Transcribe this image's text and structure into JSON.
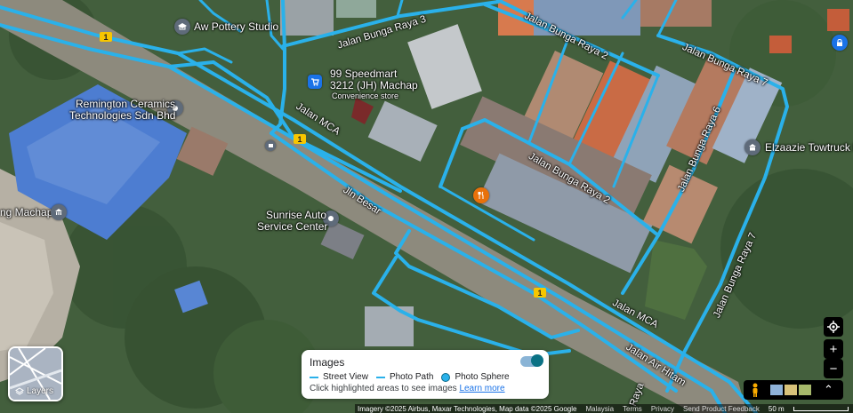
{
  "map": {
    "road_labels": {
      "bunga_raya_3": "Jalan Bunga Raya 3",
      "bunga_raya_2_top": "Jalan Bunga Raya 2",
      "bunga_raya_7_top": "Jalan Bunga Raya 7",
      "bunga_raya_6": "Jalan Bunga Raya 6",
      "bunga_raya_2_mid": "Jalan Bunga Raya 2",
      "bunga_raya_7_right": "Jalan Bunga Raya 7",
      "mca_top": "Jalan MCA",
      "mca_bottom": "Jalan MCA",
      "jln_besar": "Jln Besar",
      "air_hitam": "Jalan Air Hitam",
      "raya_partial": "Raya"
    },
    "route_shields": [
      "1",
      "1",
      "1"
    ],
    "places": {
      "aw_pottery": "Aw Pottery Studio",
      "speedmart_line1": "99 Speedmart",
      "speedmart_line2": "3212 (JH) Machap",
      "speedmart_type": "Convenience store",
      "remington_line1": "Remington Ceramics",
      "remington_line2": "Technologies Sdn Bhd",
      "machap_partial": "ng Machap",
      "sunrise_line1": "Sunrise Auto",
      "sunrise_line2": "Service Center",
      "towtruck": "Elzaazie Towtruck En"
    }
  },
  "layers_button": {
    "label": "Layers"
  },
  "images_panel": {
    "title": "Images",
    "legend": {
      "street_view": "Street View",
      "photo_path": "Photo Path",
      "photo_sphere": "Photo Sphere"
    },
    "hint": "Click highlighted areas to see images",
    "learn_more": "Learn more",
    "toggle_on": true
  },
  "controls": {
    "zoom_in": "+",
    "zoom_out": "−",
    "my_location": "◎"
  },
  "attribution": {
    "imagery": "Imagery ©2025 Airbus, Maxar Technologies, Map data ©2025 Google",
    "country": "Malaysia",
    "terms": "Terms",
    "privacy": "Privacy",
    "feedback": "Send Product Feedback",
    "scale": "50 m"
  },
  "colors": {
    "street_view_line": "#2ab1ea",
    "vegetation": "#3f5f38",
    "roof_blue": "#4b7bd2",
    "roof_orange": "#d9653b",
    "panel_accent": "#1a73e8"
  }
}
